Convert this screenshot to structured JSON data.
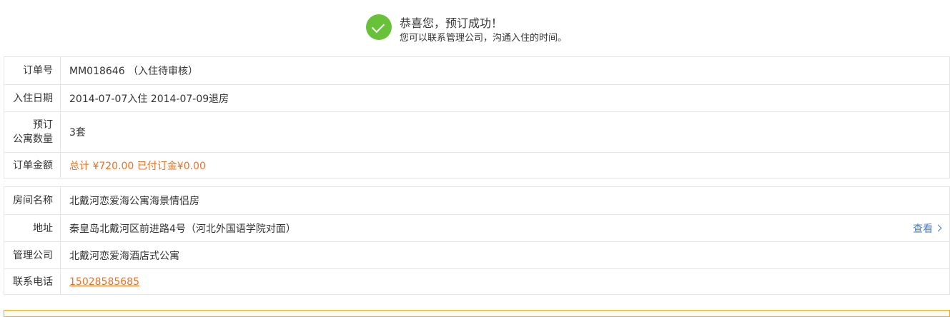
{
  "banner": {
    "title": "恭喜您，预订成功！",
    "subtitle": "您可以联系管理公司，沟通入住的时间。",
    "icon": "check-circle-icon",
    "icon_color": "#67c23a"
  },
  "order": {
    "order_no_label": "订单号",
    "order_no_value": "MM018646 （入住待审核）",
    "dates_label": "入住日期",
    "dates_value": "2014-07-07入住  2014-07-09退房",
    "count_label_line1": "预订",
    "count_label_line2": "公寓数量",
    "count_value": "3套",
    "amount_label": "订单金额",
    "amount_value": "总计 ¥720.00  已付订金¥0.00",
    "amount_color": "#f07022"
  },
  "room": {
    "name_label": "房间名称",
    "name_value": "北戴河恋爱海公寓海景情侣房",
    "address_label": "地址",
    "address_value": "秦皇岛北戴河区前进路4号（河北外国语学院对面）",
    "view_label": "查看",
    "company_label": "管理公司",
    "company_value": "北戴河恋爱海酒店式公寓",
    "phone_label": "联系电话",
    "phone_value": "15028585685",
    "link_color": "#3a7bd5"
  }
}
